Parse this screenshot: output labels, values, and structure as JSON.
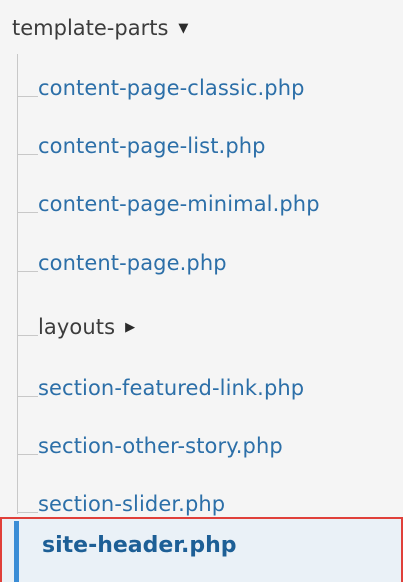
{
  "folder": {
    "name": "template-parts",
    "expanded_icon": "caret-down-icon"
  },
  "items": [
    {
      "label": "content-page-classic.php",
      "type": "file"
    },
    {
      "label": "content-page-list.php",
      "type": "file"
    },
    {
      "label": "content-page-minimal.php",
      "type": "file"
    },
    {
      "label": "content-page.php",
      "type": "file"
    },
    {
      "label": "layouts",
      "type": "folder",
      "collapsed_icon": "caret-right-icon"
    },
    {
      "label": "section-featured-link.php",
      "type": "file"
    },
    {
      "label": "section-other-story.php",
      "type": "file"
    },
    {
      "label": "section-slider.php",
      "type": "file"
    }
  ],
  "selected": {
    "label": "site-header.php"
  },
  "colors": {
    "file_link": "#2c6fa8",
    "folder_text": "#3c3c3c",
    "selection_outline": "#e0403a",
    "selection_bar": "#3a8dd6",
    "selection_bg": "#eaf1f7"
  }
}
